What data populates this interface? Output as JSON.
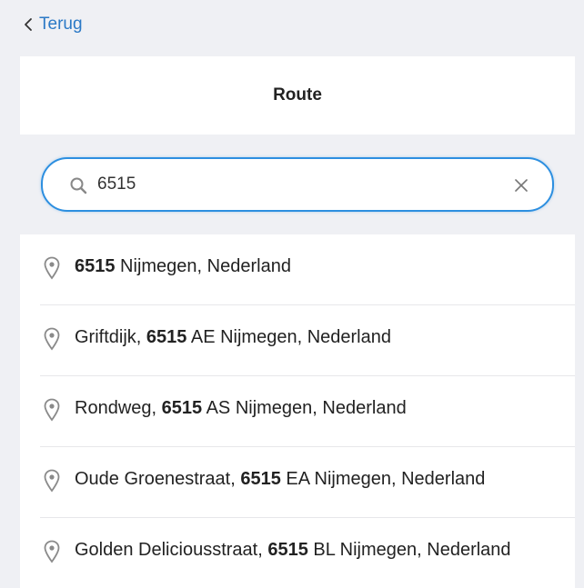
{
  "nav": {
    "back_label": "Terug"
  },
  "header": {
    "title": "Route"
  },
  "search": {
    "value": "6515"
  },
  "results": [
    {
      "prefix": "",
      "match": "6515",
      "suffix": " Nijmegen, Nederland"
    },
    {
      "prefix": "Griftdijk, ",
      "match": "6515",
      "suffix": " AE Nijmegen, Nederland"
    },
    {
      "prefix": "Rondweg, ",
      "match": "6515",
      "suffix": " AS Nijmegen, Nederland"
    },
    {
      "prefix": "Oude Groenestraat, ",
      "match": "6515",
      "suffix": " EA Nijmegen, Nederland"
    },
    {
      "prefix": "Golden Deliciousstraat, ",
      "match": "6515",
      "suffix": " BL Nijmegen, Nederland"
    }
  ],
  "colors": {
    "accent": "#2b79c6",
    "focus_border": "#2d8fe0",
    "background": "#eff0f4"
  },
  "icons": [
    "chevron-left-icon",
    "search-icon",
    "close-icon",
    "location-pin-icon"
  ]
}
